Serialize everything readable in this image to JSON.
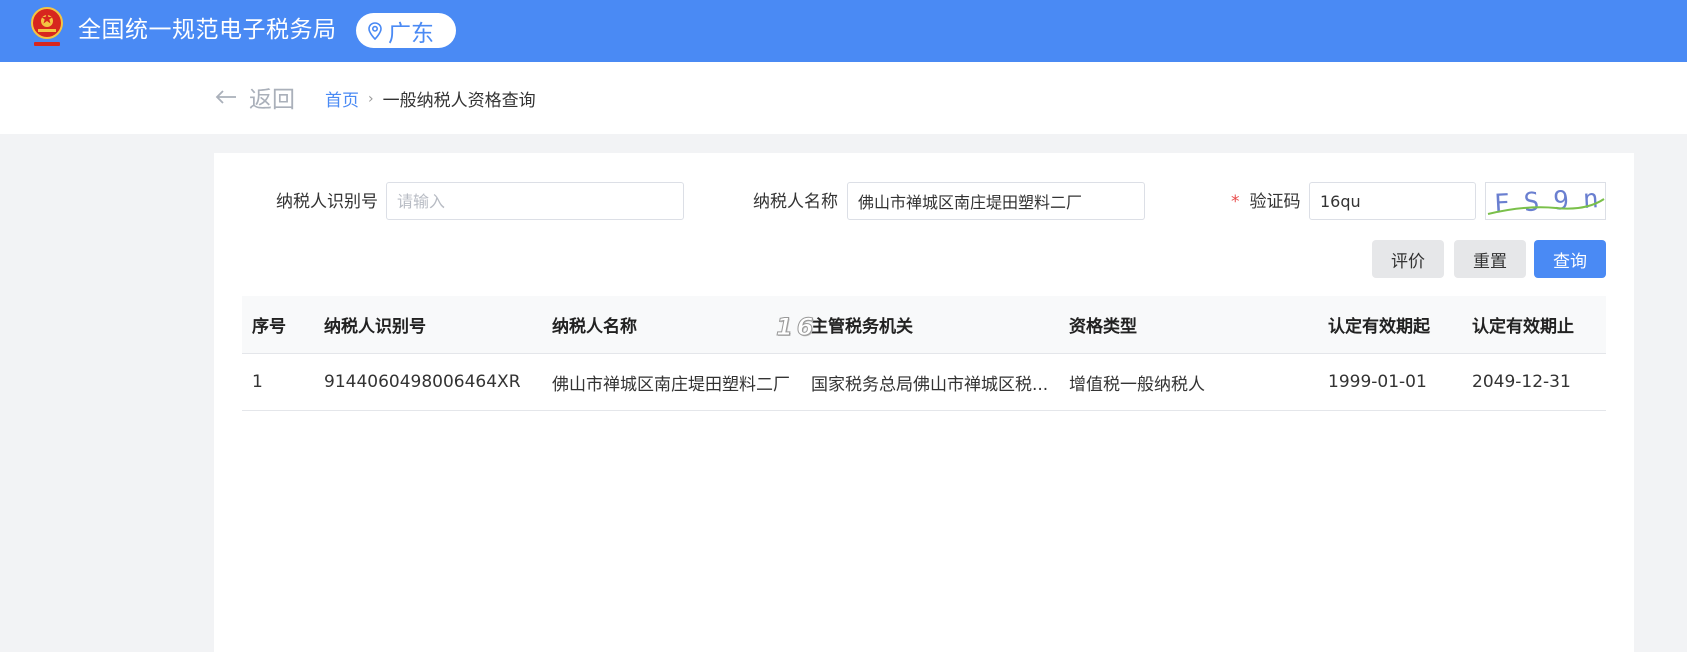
{
  "header": {
    "site_title": "全国统一规范电子税务局",
    "region": "广东",
    "brand_color": "#4a8af4"
  },
  "nav": {
    "back_label": "返回",
    "breadcrumb_home": "首页",
    "breadcrumb_separator": "›",
    "breadcrumb_current": "一般纳税人资格查询"
  },
  "form": {
    "taxpayer_id_label": "纳税人识别号",
    "taxpayer_id_placeholder": "请输入",
    "taxpayer_id_value": "",
    "taxpayer_name_label": "纳税人名称",
    "taxpayer_name_value": "佛山市禅城区南庄堤田塑料二厂",
    "captcha_required_mark": "*",
    "captcha_label": "验证码",
    "captcha_value": "16qu",
    "captcha_image_text": "FS9n"
  },
  "buttons": {
    "evaluate": "评价",
    "reset": "重置",
    "query": "查询"
  },
  "table": {
    "columns": [
      "序号",
      "纳税人识别号",
      "纳税人名称",
      "主管税务机关",
      "资格类型",
      "认定有效期起",
      "认定有效期止"
    ],
    "rows": [
      [
        "1",
        "9144060498006464XR",
        "佛山市禅城区南庄堤田塑料二厂",
        "国家税务总局佛山市禅城区税...",
        "增值税一般纳税人",
        "1999-01-01",
        "2049-12-31"
      ]
    ]
  },
  "overlay_watermark": "16"
}
